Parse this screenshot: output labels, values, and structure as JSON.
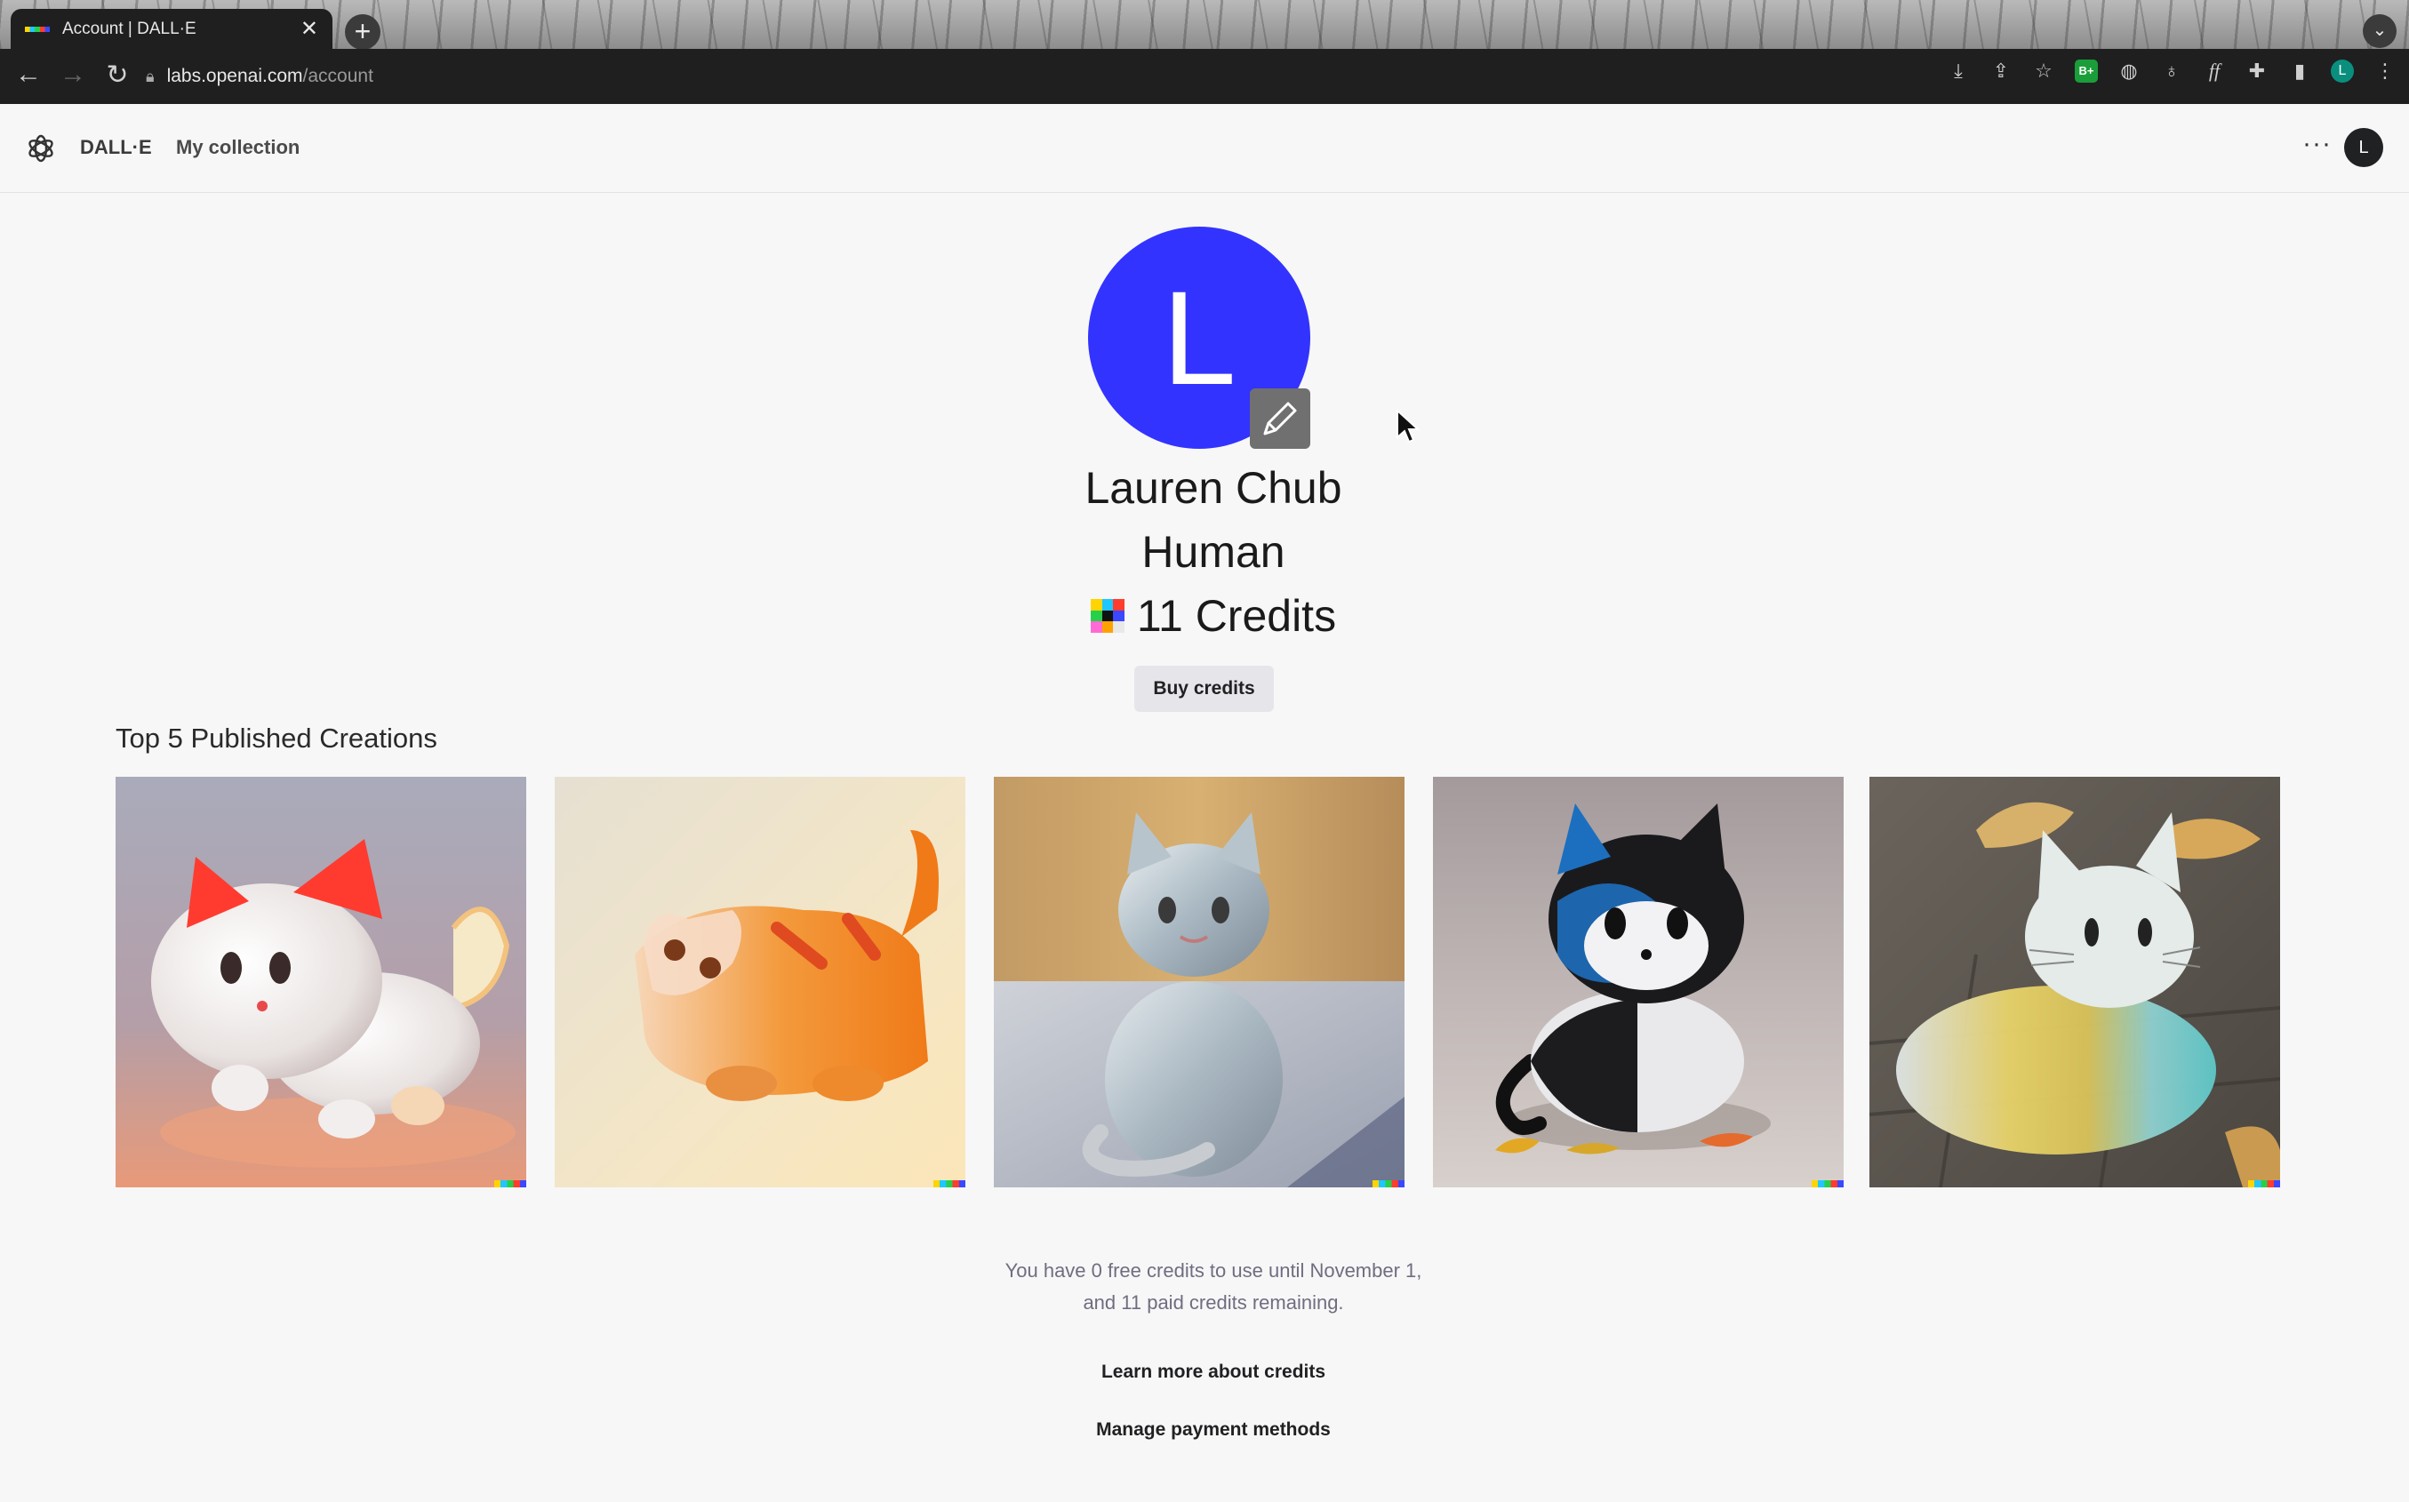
{
  "browser": {
    "tab_title": "Account | DALL·E",
    "tab_close": "✕",
    "new_tab": "+",
    "url_host": "labs.openai.com",
    "url_path": "/account",
    "toolbar_icons": [
      "download-icon",
      "share-icon",
      "star-icon",
      "extension-b-icon",
      "extension-shield-icon",
      "bulb-icon",
      "font-icon",
      "puzzle-icon",
      "sidebar-icon",
      "profile-icon",
      "kebab-menu-icon"
    ],
    "extension_label": "B+",
    "profile_initial": "L"
  },
  "header": {
    "brand": "DALL·E",
    "collection": "My collection",
    "more": "···",
    "avatar_initial": "L"
  },
  "profile": {
    "avatar_initial": "L",
    "avatar_color": "#3333ff",
    "name": "Lauren Chub",
    "role": "Human",
    "credits": "11 Credits",
    "buy_button": "Buy credits"
  },
  "creations": {
    "title": "Top 5 Published Creations",
    "items": [
      {
        "description": "glossy white cat figurine with red ears"
      },
      {
        "description": "glossy orange striped cat figurine"
      },
      {
        "description": "translucent glass cat sitting"
      },
      {
        "description": "black and white glossy cat with autumn leaves"
      },
      {
        "description": "pastel translucent cat loaf on stone"
      }
    ]
  },
  "footer": {
    "credit_note_line1": "You have 0 free credits to use until November 1,",
    "credit_note_line2": "and 11 paid credits remaining.",
    "learn_more": "Learn more about credits",
    "manage_payment": "Manage payment methods"
  }
}
